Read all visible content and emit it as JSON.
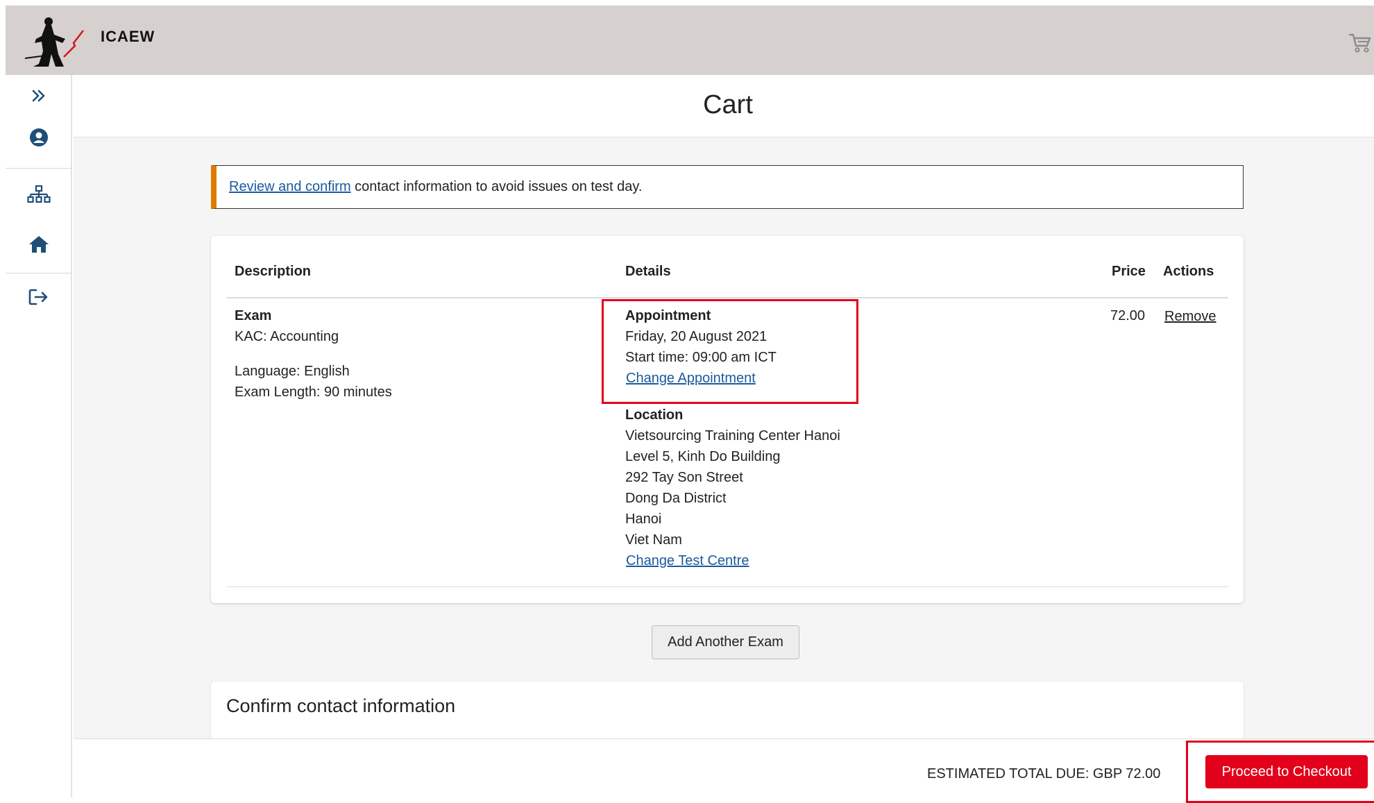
{
  "brand": {
    "name": "ICAEW"
  },
  "header": {
    "cart_icon": "cart-icon"
  },
  "sidebar": {
    "items": [
      {
        "icon": "chevron-double-right-icon"
      },
      {
        "icon": "user-circle-icon"
      },
      {
        "icon": "sitemap-icon"
      },
      {
        "icon": "home-icon"
      },
      {
        "icon": "logout-icon"
      }
    ],
    "icon_color": "#1f4e79"
  },
  "page": {
    "title": "Cart"
  },
  "notice": {
    "link_text": "Review and confirm",
    "text": " contact information to avoid issues on test day.",
    "accent_color": "#e07b00"
  },
  "table": {
    "headers": {
      "description": "Description",
      "details": "Details",
      "price": "Price",
      "actions": "Actions"
    },
    "row": {
      "description": {
        "type": "Exam",
        "name": "KAC: Accounting",
        "language": "Language: English",
        "length": "Exam Length: 90 minutes"
      },
      "appointment": {
        "heading": "Appointment",
        "date": "Friday, 20 August 2021",
        "start_time": "Start time: 09:00 am ICT",
        "change_link": "Change Appointment"
      },
      "location": {
        "heading": "Location",
        "lines": [
          "Vietsourcing Training Center Hanoi",
          "Level 5, Kinh Do Building",
          "292 Tay Son Street",
          "Dong Da District",
          "Hanoi",
          "Viet Nam"
        ],
        "change_link": "Change Test Centre"
      },
      "price": "72.00",
      "action": "Remove"
    }
  },
  "buttons": {
    "add_exam": "Add Another Exam",
    "checkout": "Proceed to Checkout"
  },
  "contact": {
    "title": "Confirm contact information"
  },
  "footer": {
    "total": "ESTIMATED TOTAL DUE: GBP 72.00"
  },
  "colors": {
    "header_bg": "#d6d1cf",
    "link": "#1a5a9b",
    "checkout": "#e3001b",
    "highlight": "#e3001b"
  }
}
